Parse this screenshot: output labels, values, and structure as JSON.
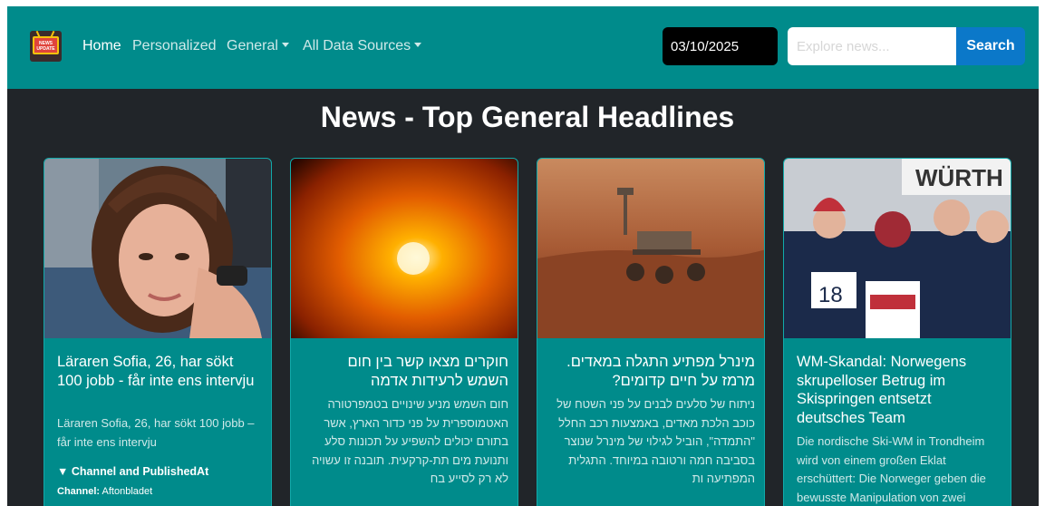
{
  "nav": {
    "logo_text": "NEWS UPDATE",
    "links": [
      "Home",
      "Personalized",
      "General",
      "All Data Sources"
    ],
    "date_value": "03/10/2025",
    "search_placeholder": "Explore news...",
    "search_button": "Search"
  },
  "page_title": "News - Top General Headlines",
  "cards": [
    {
      "title": "Läraren Sofia, 26, har sökt 100 jobb - får inte ens intervju",
      "description": "Läraren Sofia, 26, har sökt 100 jobb – får inte ens intervju",
      "details_toggle": "▼ Channel and PublishedAt",
      "channel_label": "Channel:",
      "channel_value": "Aftonbladet",
      "image_icon": "portrait-photo"
    },
    {
      "title": "חוקרים מצאו קשר בין חום השמש לרעידות אדמה",
      "description": "חום השמש מניע שינויים בטמפרטורה האטמוספרית על פני כדור הארץ, אשר בתורם יכולים להשפיע על תכונות סלע ותנועת מים תת-קרקעית. תובנה זו עשויה לא רק לסייע בח",
      "image_icon": "sun-photo"
    },
    {
      "title": "מינרל מפתיע התגלה במאדים. מרמז על חיים קדומים?",
      "description": "ניתוח של סלעים לבנים על פני השטח של כוכב הלכת מאדים, באמצעות רכב החלל \"התמדה\", הוביל לגילוי של מינרל שנוצר בסביבה חמה ורטובה במיוחד. התגלית המפתיעה ות",
      "image_icon": "mars-rover-photo"
    },
    {
      "title": "WM-Skandal: Norwegens skrupelloser Betrug im Skispringen entsetzt deutsches Team",
      "description": "Die nordische Ski-WM in Trondheim wird von einem großen Eklat erschüttert: Die Norweger geben die bewusste Manipulation von zwei",
      "image_icon": "ski-jumpers-photo"
    }
  ],
  "colors": {
    "navbar": "#008b8b",
    "page_bg": "#212529",
    "card": "#008b8b",
    "search_button": "#0b78c9"
  }
}
